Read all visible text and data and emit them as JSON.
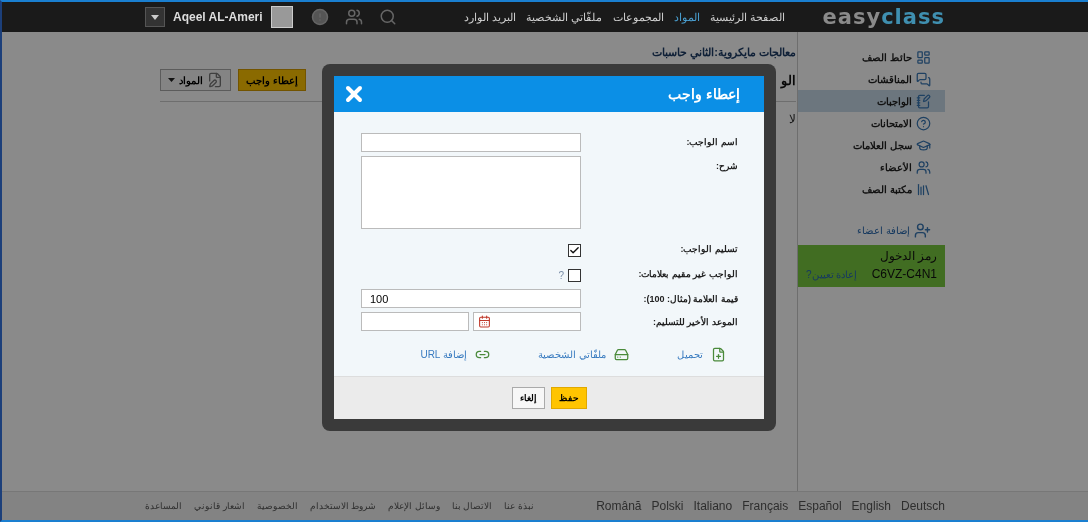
{
  "top_bar": {
    "logo": [
      {
        "text": "class",
        "color": "#3f8fb0"
      },
      {
        "text": "easy",
        "color": "#8a8a8a"
      }
    ],
    "nav": [
      {
        "label": "الصفحة الرئيسية",
        "selected": false
      },
      {
        "label": "المواد",
        "selected": true
      },
      {
        "label": "المجموعات",
        "selected": false
      },
      {
        "label": "ملفّاتي الشخصية",
        "selected": false
      },
      {
        "label": "البريد الوارد",
        "selected": false
      }
    ],
    "user_name": "Aqeel AL-Ameri"
  },
  "content": {
    "breadcrumb": "معالجات مايكروية:الثاني حاسبات",
    "heading": "الو",
    "note": "لا",
    "buttons": [
      {
        "label": "إعطاء واجب",
        "kind": "primary"
      },
      {
        "label": "المواد",
        "kind": "dropdown"
      }
    ]
  },
  "sidebar": {
    "items": [
      {
        "label": "حائط الصف",
        "selected": false
      },
      {
        "label": "المناقشات",
        "selected": false
      },
      {
        "label": "الواجبات",
        "selected": true
      },
      {
        "label": "الامتحانات",
        "selected": false
      },
      {
        "label": "سجل العلامات",
        "selected": false
      },
      {
        "label": "الأعضاء",
        "selected": false
      },
      {
        "label": "مكتبة الصف",
        "selected": false
      }
    ],
    "add_members": "إضافة اعضاء",
    "access_code": {
      "title": "رمز الدخول",
      "code": "C6VZ-C4N1",
      "reset": "إعادة تعيين?"
    }
  },
  "dialog": {
    "title": "إعطاء واجب",
    "fields": [
      {
        "label": "اسم الواجب:",
        "kind": "text"
      },
      {
        "label": "شرح:",
        "kind": "textarea"
      },
      {
        "label": "تسليم الواجب:",
        "kind": "checkbox",
        "checked": true
      },
      {
        "label": "الواجب غير مقيم بعلامات:",
        "kind": "checkbox",
        "checked": false,
        "help": "?"
      },
      {
        "label": "قيمة العلامة (مثال: 100):",
        "kind": "text",
        "value": "100"
      },
      {
        "label": "الموعد الأخير للتسليم:",
        "kind": "datetime"
      }
    ],
    "attachments": [
      {
        "label": "تحميل",
        "kind": "upload"
      },
      {
        "label": "ملفّاتي الشخصية",
        "kind": "files"
      },
      {
        "label": "إضافة URL",
        "kind": "url"
      }
    ],
    "buttons": [
      {
        "label": "حفظ",
        "kind": "primary"
      },
      {
        "label": "إلغاء",
        "kind": "secondary"
      }
    ]
  },
  "footer": {
    "links": [
      "نبذة عنا",
      "الاتصال بنا",
      "وسائل الإعلام",
      "شروط الاستخدام",
      "الخصوصية",
      "اشعار قانوني",
      "المساعدة"
    ],
    "languages": [
      "Deutsch",
      "English",
      "Español",
      "Français",
      "Italiano",
      "Polski",
      "Română"
    ]
  }
}
